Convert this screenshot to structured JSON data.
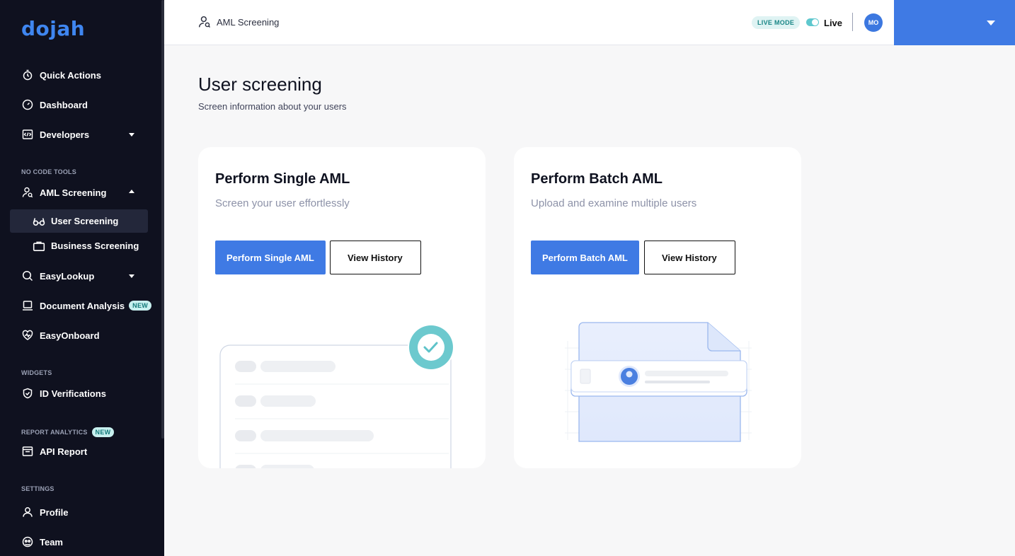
{
  "brand": {
    "logo_text": "dojah"
  },
  "sidebar": {
    "items": {
      "quick_actions": "Quick Actions",
      "dashboard": "Dashboard",
      "developers": "Developers",
      "aml_screening": "AML Screening",
      "user_screening": "User Screening",
      "business_screening": "Business Screening",
      "easylookup": "EasyLookup",
      "document_analysis": "Document Analysis",
      "easyonboard": "EasyOnboard",
      "id_verifications": "ID Verifications",
      "api_report": "API Report",
      "profile": "Profile",
      "team": "Team"
    },
    "sections": {
      "no_code_tools": "NO CODE TOOLS",
      "widgets": "WIDGETS",
      "report_analytics": "REPORT ANALYTICS",
      "settings": "SETTINGS"
    },
    "badges": {
      "new": "NEW"
    }
  },
  "header": {
    "breadcrumb": "AML Screening",
    "mode_badge": "LIVE MODE",
    "live_label": "Live",
    "avatar_initials": "MO"
  },
  "main": {
    "title": "User screening",
    "subtitle": "Screen information about your users",
    "cards": [
      {
        "title": "Perform Single AML",
        "description": "Screen your user effortlessly",
        "primary_label": "Perform Single AML",
        "secondary_label": "View History"
      },
      {
        "title": "Perform Batch AML",
        "description": "Upload and examine multiple users",
        "primary_label": "Perform Batch AML",
        "secondary_label": "View History"
      }
    ]
  },
  "colors": {
    "sidebar_bg": "#0f111f",
    "accent_blue": "#3f7ae4",
    "teal": "#5fc8ce",
    "page_bg": "#f7f7f8"
  }
}
